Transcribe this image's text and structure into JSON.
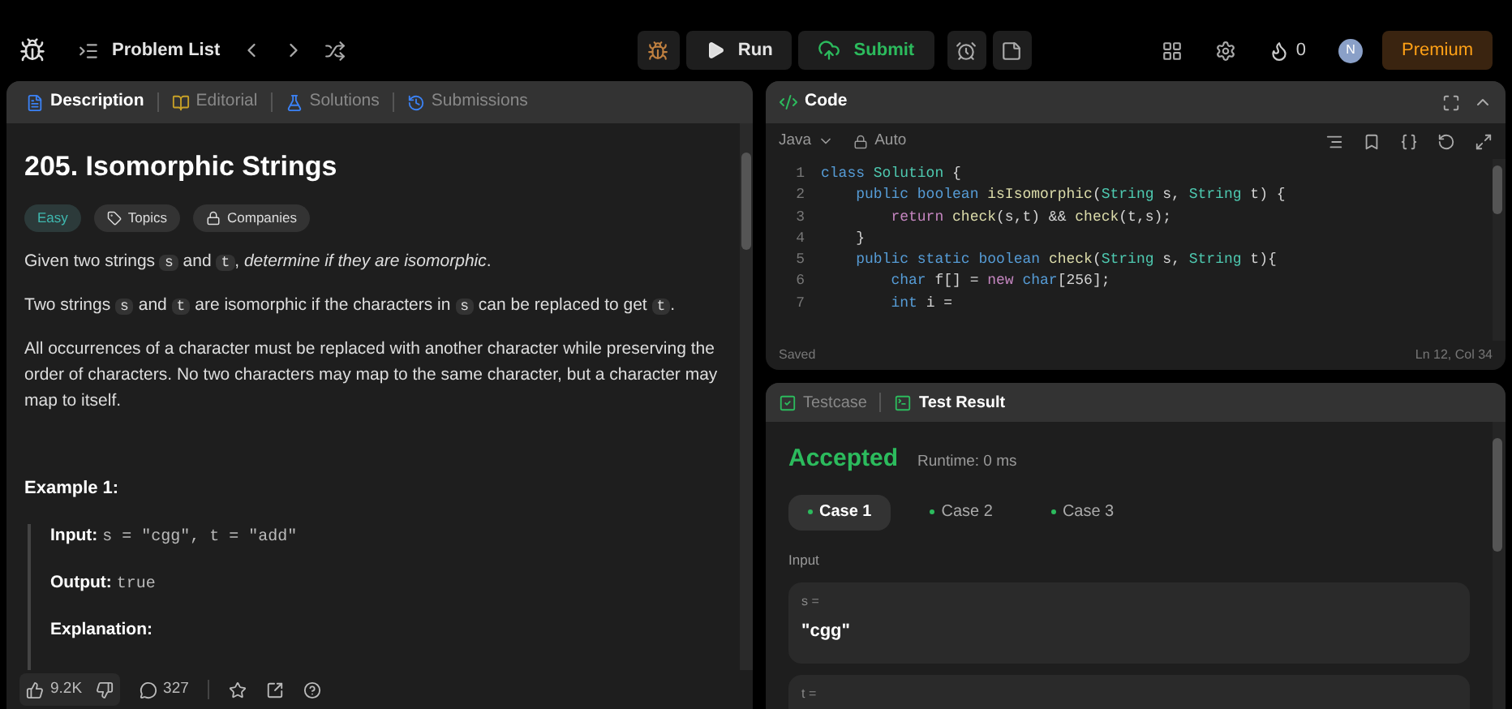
{
  "topbar": {
    "problem_list": "Problem List",
    "run": "Run",
    "submit": "Submit",
    "streak": "0",
    "avatar": "N",
    "premium": "Premium"
  },
  "left_tabs": [
    {
      "label": "Description",
      "selected": true
    },
    {
      "label": "Editorial",
      "selected": false
    },
    {
      "label": "Solutions",
      "selected": false
    },
    {
      "label": "Submissions",
      "selected": false
    }
  ],
  "problem": {
    "title": "205. Isomorphic Strings",
    "difficulty": "Easy",
    "tags": [
      "Topics",
      "Companies"
    ],
    "paragraphs": [
      [
        {
          "kind": "text",
          "text": "Given two strings "
        },
        {
          "kind": "code",
          "text": "s"
        },
        {
          "kind": "text",
          "text": " and "
        },
        {
          "kind": "code",
          "text": "t"
        },
        {
          "kind": "text",
          "text": ", "
        },
        {
          "kind": "em",
          "text": "determine if they are isomorphic"
        },
        {
          "kind": "text",
          "text": "."
        }
      ],
      [
        {
          "kind": "text",
          "text": "Two strings "
        },
        {
          "kind": "code",
          "text": "s"
        },
        {
          "kind": "text",
          "text": " and "
        },
        {
          "kind": "code",
          "text": "t"
        },
        {
          "kind": "text",
          "text": " are isomorphic if the characters in "
        },
        {
          "kind": "code",
          "text": "s"
        },
        {
          "kind": "text",
          "text": " can be replaced to get "
        },
        {
          "kind": "code",
          "text": "t"
        },
        {
          "kind": "text",
          "text": "."
        }
      ],
      [
        {
          "kind": "text",
          "text": "All occurrences of a character must be replaced with another character while preserving the order of characters. No two characters may map to the same character, but a character may map to itself."
        }
      ]
    ],
    "example": {
      "title": "Example 1:",
      "input_label": "Input:",
      "input": "s = \"cgg\", t = \"add\"",
      "output_label": "Output:",
      "output": "true",
      "explanation_label": "Explanation:"
    }
  },
  "footer": {
    "likes": "9.2K",
    "comments": "327"
  },
  "code_panel": {
    "title": "Code",
    "language": "Java",
    "mode": "Auto",
    "status": "Saved",
    "position": "Ln 12, Col 34",
    "lines": [
      {
        "n": "1",
        "tokens": [
          {
            "kind": "kw",
            "text": "class "
          },
          {
            "kind": "type",
            "text": "Solution"
          },
          {
            "kind": "plain",
            "text": " {"
          }
        ]
      },
      {
        "n": "2",
        "tokens": [
          {
            "kind": "kw",
            "text": "    public boolean "
          },
          {
            "kind": "fn",
            "text": "isIsomorphic"
          },
          {
            "kind": "plain",
            "text": "("
          },
          {
            "kind": "type",
            "text": "String"
          },
          {
            "kind": "plain",
            "text": " s, "
          },
          {
            "kind": "type",
            "text": "String"
          },
          {
            "kind": "plain",
            "text": " t) {"
          }
        ]
      },
      {
        "n": "3",
        "tokens": [
          {
            "kind": "ctrl",
            "text": "        return "
          },
          {
            "kind": "fn",
            "text": "check"
          },
          {
            "kind": "plain",
            "text": "(s,t) && "
          },
          {
            "kind": "fn",
            "text": "check"
          },
          {
            "kind": "plain",
            "text": "(t,s);"
          }
        ]
      },
      {
        "n": "4",
        "tokens": [
          {
            "kind": "plain",
            "text": "    }"
          }
        ]
      },
      {
        "n": "5",
        "tokens": [
          {
            "kind": "kw",
            "text": "    public static boolean "
          },
          {
            "kind": "fn",
            "text": "check"
          },
          {
            "kind": "plain",
            "text": "("
          },
          {
            "kind": "type",
            "text": "String"
          },
          {
            "kind": "plain",
            "text": " s, "
          },
          {
            "kind": "type",
            "text": "String"
          },
          {
            "kind": "plain",
            "text": " t){"
          }
        ]
      },
      {
        "n": "6",
        "tokens": [
          {
            "kind": "kw",
            "text": "        char "
          },
          {
            "kind": "plain",
            "text": "f[] = "
          },
          {
            "kind": "ctrl",
            "text": "new "
          },
          {
            "kind": "kw",
            "text": "char"
          },
          {
            "kind": "plain",
            "text": "[256];"
          }
        ]
      },
      {
        "n": "7",
        "tokens": [
          {
            "kind": "kw",
            "text": "        int "
          },
          {
            "kind": "plain",
            "text": "i ="
          }
        ]
      }
    ]
  },
  "result_tabs": [
    {
      "label": "Testcase",
      "selected": false
    },
    {
      "label": "Test Result",
      "selected": true
    }
  ],
  "result": {
    "verdict": "Accepted",
    "runtime": "Runtime: 0 ms",
    "cases": [
      {
        "label": "Case 1",
        "selected": true
      },
      {
        "label": "Case 2",
        "selected": false
      },
      {
        "label": "Case 3",
        "selected": false
      }
    ],
    "input_label": "Input",
    "params": [
      {
        "name": "s =",
        "value": "\"cgg\""
      },
      {
        "name": "t ="
      }
    ]
  }
}
